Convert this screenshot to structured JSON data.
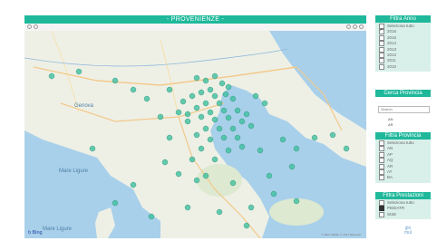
{
  "map_panel": {
    "title": "- PROVENIENZE -",
    "labels": {
      "genova": "Genova",
      "mare_ligure_1": "Mare Ligure",
      "mare_ligure_2": "Mare Ligure",
      "bing": "b Bing"
    },
    "copyright": "© 2017 HERE, © 2017 Microsoft"
  },
  "filtra_anno": {
    "title": "Filtra Anno",
    "options": [
      {
        "label": "Seleziona tutto",
        "checked": false
      },
      {
        "label": "2016",
        "checked": true
      },
      {
        "label": "2015",
        "checked": false
      },
      {
        "label": "2014",
        "checked": false
      },
      {
        "label": "2013",
        "checked": false
      },
      {
        "label": "2012",
        "checked": false
      },
      {
        "label": "2011",
        "checked": false
      },
      {
        "label": "2010",
        "checked": false
      }
    ]
  },
  "cerca_provincia": {
    "title": "Cerca Provincia",
    "placeholder": "Search",
    "items": [
      "AN",
      "AR"
    ]
  },
  "filtra_provincia": {
    "title": "Filtra Provincia",
    "options": [
      {
        "label": "Seleziona tutto",
        "checked": false
      },
      {
        "label": "AN",
        "checked": false
      },
      {
        "label": "AP",
        "checked": false
      },
      {
        "label": "AQ",
        "checked": false
      },
      {
        "label": "AR",
        "checked": false
      },
      {
        "label": "AT",
        "checked": false
      },
      {
        "label": "BA",
        "checked": false
      }
    ]
  },
  "filtra_prestazioni": {
    "title": "Filtra Prestazioni",
    "options": [
      {
        "label": "Seleziona tutto",
        "checked": false
      },
      {
        "label": "PEDIATR",
        "checked": true
      },
      {
        "label": "SISE",
        "checked": false
      }
    ]
  },
  "logo": {
    "text": "glo\nmul"
  },
  "colors": {
    "accent": "#1fb89b",
    "panel_bg": "#d9f0ea",
    "marker": "#3fbf9f",
    "sea": "#a9d0ea"
  }
}
